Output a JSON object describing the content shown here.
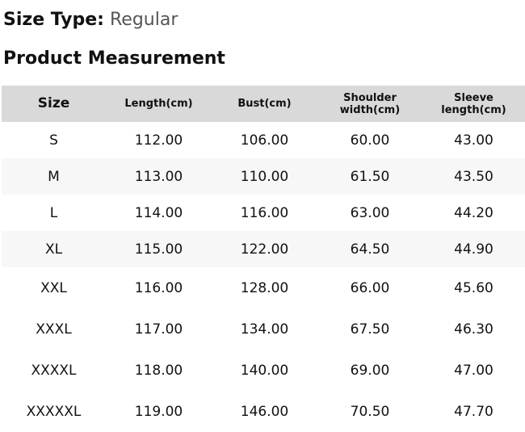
{
  "size_type": {
    "label": "Size Type:",
    "value": "Regular"
  },
  "section_title": "Product Measurement",
  "table": {
    "headers": [
      "Size",
      "Length(cm)",
      "Bust(cm)",
      "Shoulder width(cm)",
      "Sleeve length(cm)"
    ],
    "rows": [
      [
        "S",
        "112.00",
        "106.00",
        "60.00",
        "43.00"
      ],
      [
        "M",
        "113.00",
        "110.00",
        "61.50",
        "43.50"
      ],
      [
        "L",
        "114.00",
        "116.00",
        "63.00",
        "44.20"
      ],
      [
        "XL",
        "115.00",
        "122.00",
        "64.50",
        "44.90"
      ],
      [
        "XXL",
        "116.00",
        "128.00",
        "66.00",
        "45.60"
      ],
      [
        "XXXL",
        "117.00",
        "134.00",
        "67.50",
        "46.30"
      ],
      [
        "XXXXL",
        "118.00",
        "140.00",
        "69.00",
        "47.00"
      ],
      [
        "XXXXXL",
        "119.00",
        "146.00",
        "70.50",
        "47.70"
      ]
    ]
  }
}
